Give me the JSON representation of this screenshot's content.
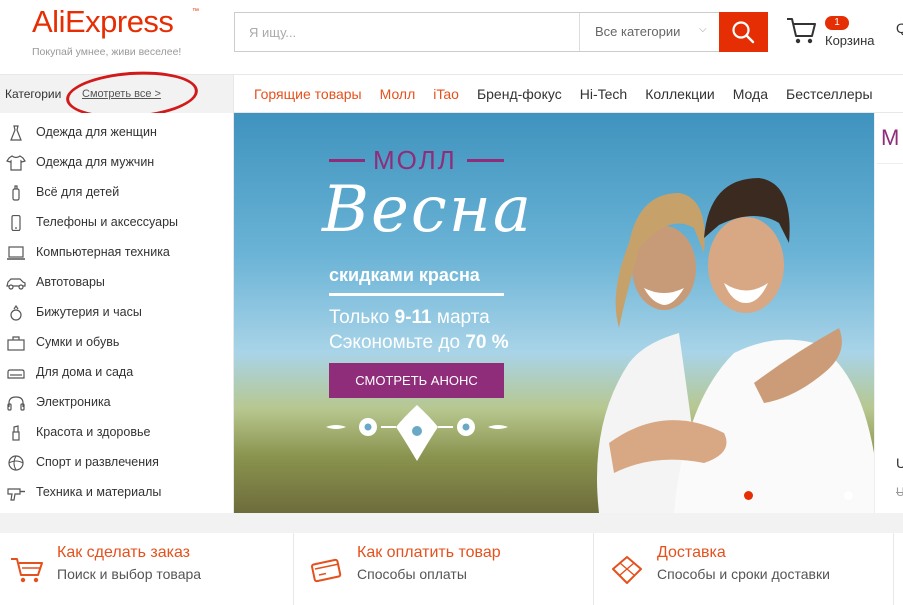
{
  "header": {
    "logo_text": "AliExpress",
    "logo_tagline": "Покупай умнее, живи веселее!",
    "search_placeholder": "Я ищу...",
    "search_category": "Все категории",
    "cart_count": "1",
    "cart_label": "Корзина"
  },
  "nav": {
    "categories_label": "Категории",
    "see_all": "Смотреть все >",
    "links": [
      "Горящие товары",
      "Молл",
      "iTao",
      "Бренд-фокус",
      "Hi-Tech",
      "Коллекции",
      "Мода",
      "Бестселлеры"
    ]
  },
  "sidebar": {
    "items": [
      {
        "label": "Одежда для женщин",
        "icon": "dress-icon"
      },
      {
        "label": "Одежда для мужчин",
        "icon": "shirt-icon"
      },
      {
        "label": "Всё для детей",
        "icon": "baby-bottle-icon"
      },
      {
        "label": "Телефоны и аксессуары",
        "icon": "phone-icon"
      },
      {
        "label": "Компьютерная техника",
        "icon": "laptop-icon"
      },
      {
        "label": "Автотовары",
        "icon": "car-icon"
      },
      {
        "label": "Бижутерия и часы",
        "icon": "ring-icon"
      },
      {
        "label": "Сумки и обувь",
        "icon": "bag-icon"
      },
      {
        "label": "Для дома и сада",
        "icon": "sofa-icon"
      },
      {
        "label": "Электроника",
        "icon": "headphones-icon"
      },
      {
        "label": "Красота и здоровье",
        "icon": "lipstick-icon"
      },
      {
        "label": "Спорт и развлечения",
        "icon": "ball-icon"
      },
      {
        "label": "Техника и материалы",
        "icon": "drill-icon"
      }
    ]
  },
  "banner": {
    "mall": "МОЛЛ",
    "title": "Весна",
    "subtitle": "скидками красна",
    "dates_prefix": "Только ",
    "dates_bold": "9-11",
    "dates_suffix": " марта",
    "save_prefix": "Сэкономьте до ",
    "save_bold": "70 %",
    "button": "СМОТРЕТЬ АНОНС",
    "accent_color": "#8f2d7a"
  },
  "right_strip": {
    "letter": "M",
    "letter2": "U",
    "price": "U"
  },
  "info": [
    {
      "title": "Как сделать заказ",
      "subtitle": "Поиск и выбор товара",
      "icon": "cart-icon"
    },
    {
      "title": "Как оплатить товар",
      "subtitle": "Способы оплаты",
      "icon": "card-icon"
    },
    {
      "title": "Доставка",
      "subtitle": "Способы и сроки доставки",
      "icon": "package-icon"
    }
  ],
  "colors": {
    "brand": "#e62e04",
    "nav_accent": "#e5511d"
  }
}
